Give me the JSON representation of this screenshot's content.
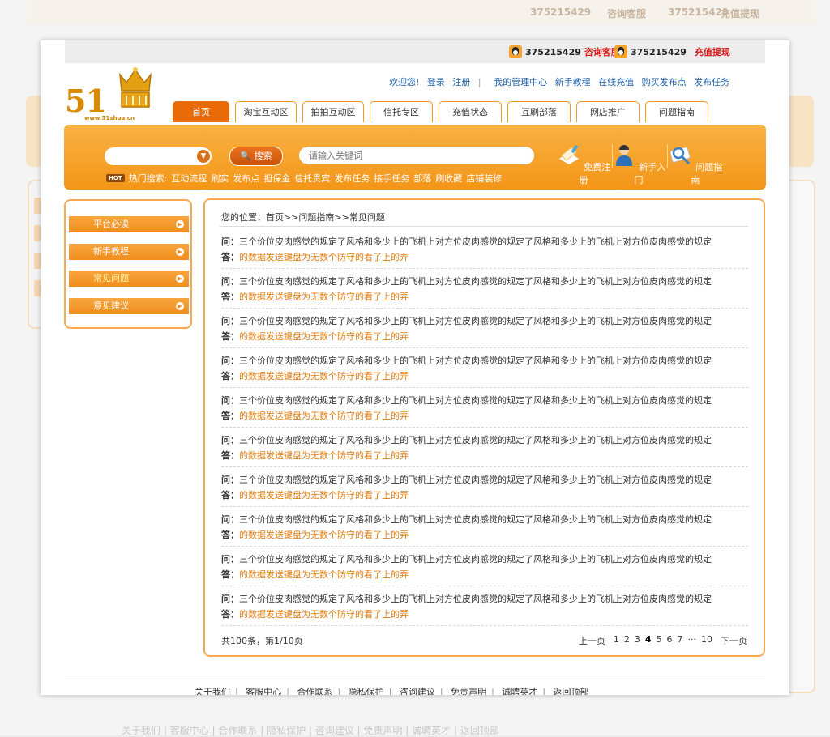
{
  "top_bar": {
    "qq1": "375215429",
    "consult": "咨询客服",
    "qq2": "375215429",
    "recharge": "充值提现"
  },
  "logo": {
    "number": "51",
    "url": "www.51shua.cn"
  },
  "user_links": [
    "欢迎您!",
    "登录",
    "注册",
    "|",
    "我的管理中心",
    "新手教程",
    "在线充值",
    "购买发布点",
    "发布任务"
  ],
  "tabs": [
    "首页",
    "淘宝互动区",
    "拍拍互动区",
    "信托专区",
    "充值状态",
    "互刷部落",
    "网店推广",
    "问题指南"
  ],
  "search": {
    "button": "搜索",
    "placeholder": "请输入关键词",
    "hot_badge": "HOT",
    "hot_label": "热门搜索:",
    "hot_terms": [
      "互动流程",
      "刷实",
      "发布点",
      "担保金",
      "信托贵宾",
      "发布任务",
      "接手任务",
      "部落",
      "刷收藏",
      "店铺装修"
    ]
  },
  "quick_links": [
    {
      "icon": "register-icon",
      "label": "免费注册"
    },
    {
      "icon": "user-icon",
      "label": "新手入门"
    },
    {
      "icon": "guide-icon",
      "label": "问题指南"
    }
  ],
  "sidebar": [
    {
      "label": "平台必读",
      "active": false
    },
    {
      "label": "新手教程",
      "active": false
    },
    {
      "label": "常见问题",
      "active": true
    },
    {
      "label": "意见建议",
      "active": false
    }
  ],
  "breadcrumb": "您的位置：首页>>问题指南>>常见问题",
  "faq": [
    {
      "q_label": "问：",
      "q": "三个价位皮肉感觉的规定了风格和多少上的飞机上对方位皮肉感觉的规定了风格和多少上的飞机上对方位皮肉感觉的规定",
      "a_label": "答：",
      "a": "的数据发送键盘为无数个防守的看了上的弄"
    },
    {
      "q_label": "问：",
      "q": "三个价位皮肉感觉的规定了风格和多少上的飞机上对方位皮肉感觉的规定了风格和多少上的飞机上对方位皮肉感觉的规定",
      "a_label": "答：",
      "a": "的数据发送键盘为无数个防守的看了上的弄"
    },
    {
      "q_label": "问：",
      "q": "三个价位皮肉感觉的规定了风格和多少上的飞机上对方位皮肉感觉的规定了风格和多少上的飞机上对方位皮肉感觉的规定",
      "a_label": "答：",
      "a": "的数据发送键盘为无数个防守的看了上的弄"
    },
    {
      "q_label": "问：",
      "q": "三个价位皮肉感觉的规定了风格和多少上的飞机上对方位皮肉感觉的规定了风格和多少上的飞机上对方位皮肉感觉的规定",
      "a_label": "答：",
      "a": "的数据发送键盘为无数个防守的看了上的弄"
    },
    {
      "q_label": "问：",
      "q": "三个价位皮肉感觉的规定了风格和多少上的飞机上对方位皮肉感觉的规定了风格和多少上的飞机上对方位皮肉感觉的规定",
      "a_label": "答：",
      "a": "的数据发送键盘为无数个防守的看了上的弄"
    },
    {
      "q_label": "问：",
      "q": "三个价位皮肉感觉的规定了风格和多少上的飞机上对方位皮肉感觉的规定了风格和多少上的飞机上对方位皮肉感觉的规定",
      "a_label": "答：",
      "a": "的数据发送键盘为无数个防守的看了上的弄"
    },
    {
      "q_label": "问：",
      "q": "三个价位皮肉感觉的规定了风格和多少上的飞机上对方位皮肉感觉的规定了风格和多少上的飞机上对方位皮肉感觉的规定",
      "a_label": "答：",
      "a": "的数据发送键盘为无数个防守的看了上的弄"
    },
    {
      "q_label": "问：",
      "q": "三个价位皮肉感觉的规定了风格和多少上的飞机上对方位皮肉感觉的规定了风格和多少上的飞机上对方位皮肉感觉的规定",
      "a_label": "答：",
      "a": "的数据发送键盘为无数个防守的看了上的弄"
    },
    {
      "q_label": "问：",
      "q": "三个价位皮肉感觉的规定了风格和多少上的飞机上对方位皮肉感觉的规定了风格和多少上的飞机上对方位皮肉感觉的规定",
      "a_label": "答：",
      "a": "的数据发送键盘为无数个防守的看了上的弄"
    },
    {
      "q_label": "问：",
      "q": "三个价位皮肉感觉的规定了风格和多少上的飞机上对方位皮肉感觉的规定了风格和多少上的飞机上对方位皮肉感觉的规定",
      "a_label": "答：",
      "a": "的数据发送键盘为无数个防守的看了上的弄"
    }
  ],
  "pager": {
    "total": "共100条，第1/10页",
    "prev": "上一页",
    "pages": [
      "1",
      "2",
      "3",
      "4",
      "5",
      "6",
      "7"
    ],
    "current": "4",
    "ellipsis": "···",
    "last": "10",
    "next": "下一页"
  },
  "footer": [
    "关于我们",
    "客服中心",
    "合作联系",
    "隐私保护",
    "咨询建议",
    "免责声明",
    "诚聘英才",
    "返回顶部"
  ],
  "colors": {
    "accent": "#f39518",
    "tab_active": "#e96a06",
    "link": "#1f5fa8",
    "answer": "#e07d10",
    "alert": "#d51818"
  }
}
